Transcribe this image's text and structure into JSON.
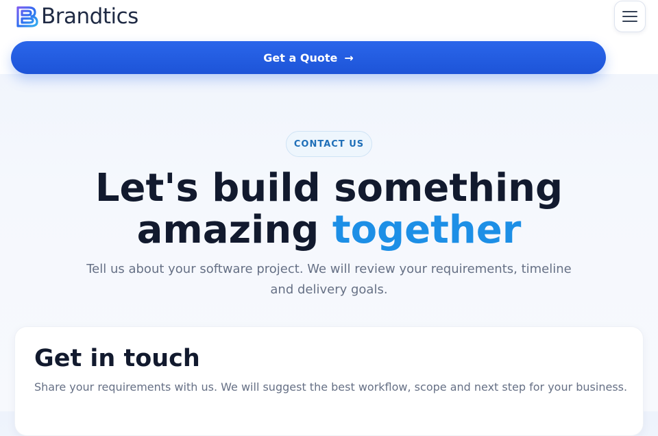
{
  "brand": {
    "name": "Brandtics",
    "logo_icon": "b-logo-icon",
    "logo_colors": [
      "#7b5cf0",
      "#2f6ff0",
      "#34b0ef"
    ]
  },
  "header": {
    "menu_icon": "hamburger-icon"
  },
  "cta": {
    "label": "Get a Quote",
    "arrow": "→",
    "color": "#2563eb"
  },
  "hero": {
    "badge": "CONTACT US",
    "title_line1": "Let's build something",
    "title_line2_plain": "amazing",
    "title_line2_accent": "together",
    "accent_color": "#1d8fe6",
    "subtitle": "Tell us about your software project. We will review your requirements, timeline and delivery goals."
  },
  "contact_card": {
    "title": "Get in touch",
    "subtitle": "Share your requirements with us. We will suggest the best workflow, scope and next step for your business."
  }
}
